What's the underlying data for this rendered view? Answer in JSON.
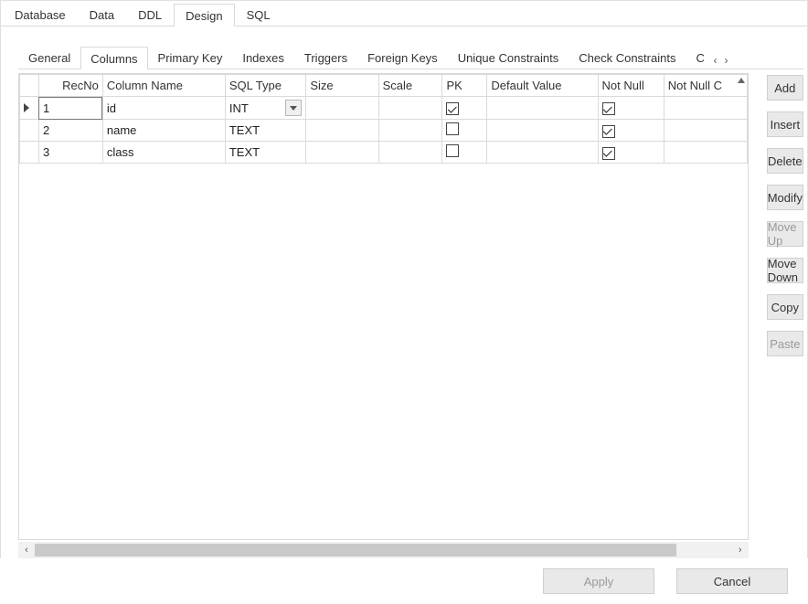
{
  "outerTabs": {
    "t0": "Database",
    "t1": "Data",
    "t2": "DDL",
    "t3": "Design",
    "t4": "SQL",
    "active": 3
  },
  "innerTabs": {
    "t0": "General",
    "t1": "Columns",
    "t2": "Primary Key",
    "t3": "Indexes",
    "t4": "Triggers",
    "t5": "Foreign Keys",
    "t6": "Unique Constraints",
    "t7": "Check Constraints",
    "t8": "C",
    "active": 1
  },
  "gridHeaders": {
    "recno": "RecNo",
    "colname": "Column Name",
    "sqltype": "SQL Type",
    "size": "Size",
    "scale": "Scale",
    "pk": "PK",
    "defval": "Default Value",
    "notnull": "Not Null",
    "notnullc": "Not Null C"
  },
  "rows": [
    {
      "recno": "1",
      "name": "id",
      "sqltype": "INT",
      "pk": true,
      "notnull": true,
      "showTypeDropdown": true,
      "current": true
    },
    {
      "recno": "2",
      "name": "name",
      "sqltype": "TEXT",
      "pk": false,
      "notnull": true,
      "showTypeDropdown": false,
      "current": false
    },
    {
      "recno": "3",
      "name": "class",
      "sqltype": "TEXT",
      "pk": false,
      "notnull": true,
      "showTypeDropdown": false,
      "current": false
    }
  ],
  "sideButtons": {
    "add": "Add",
    "insert": "Insert",
    "delete": "Delete",
    "modify": "Modify",
    "moveup": "Move Up",
    "movedown": "Move Down",
    "copy": "Copy",
    "paste": "Paste"
  },
  "footerButtons": {
    "apply": "Apply",
    "cancel": "Cancel"
  }
}
